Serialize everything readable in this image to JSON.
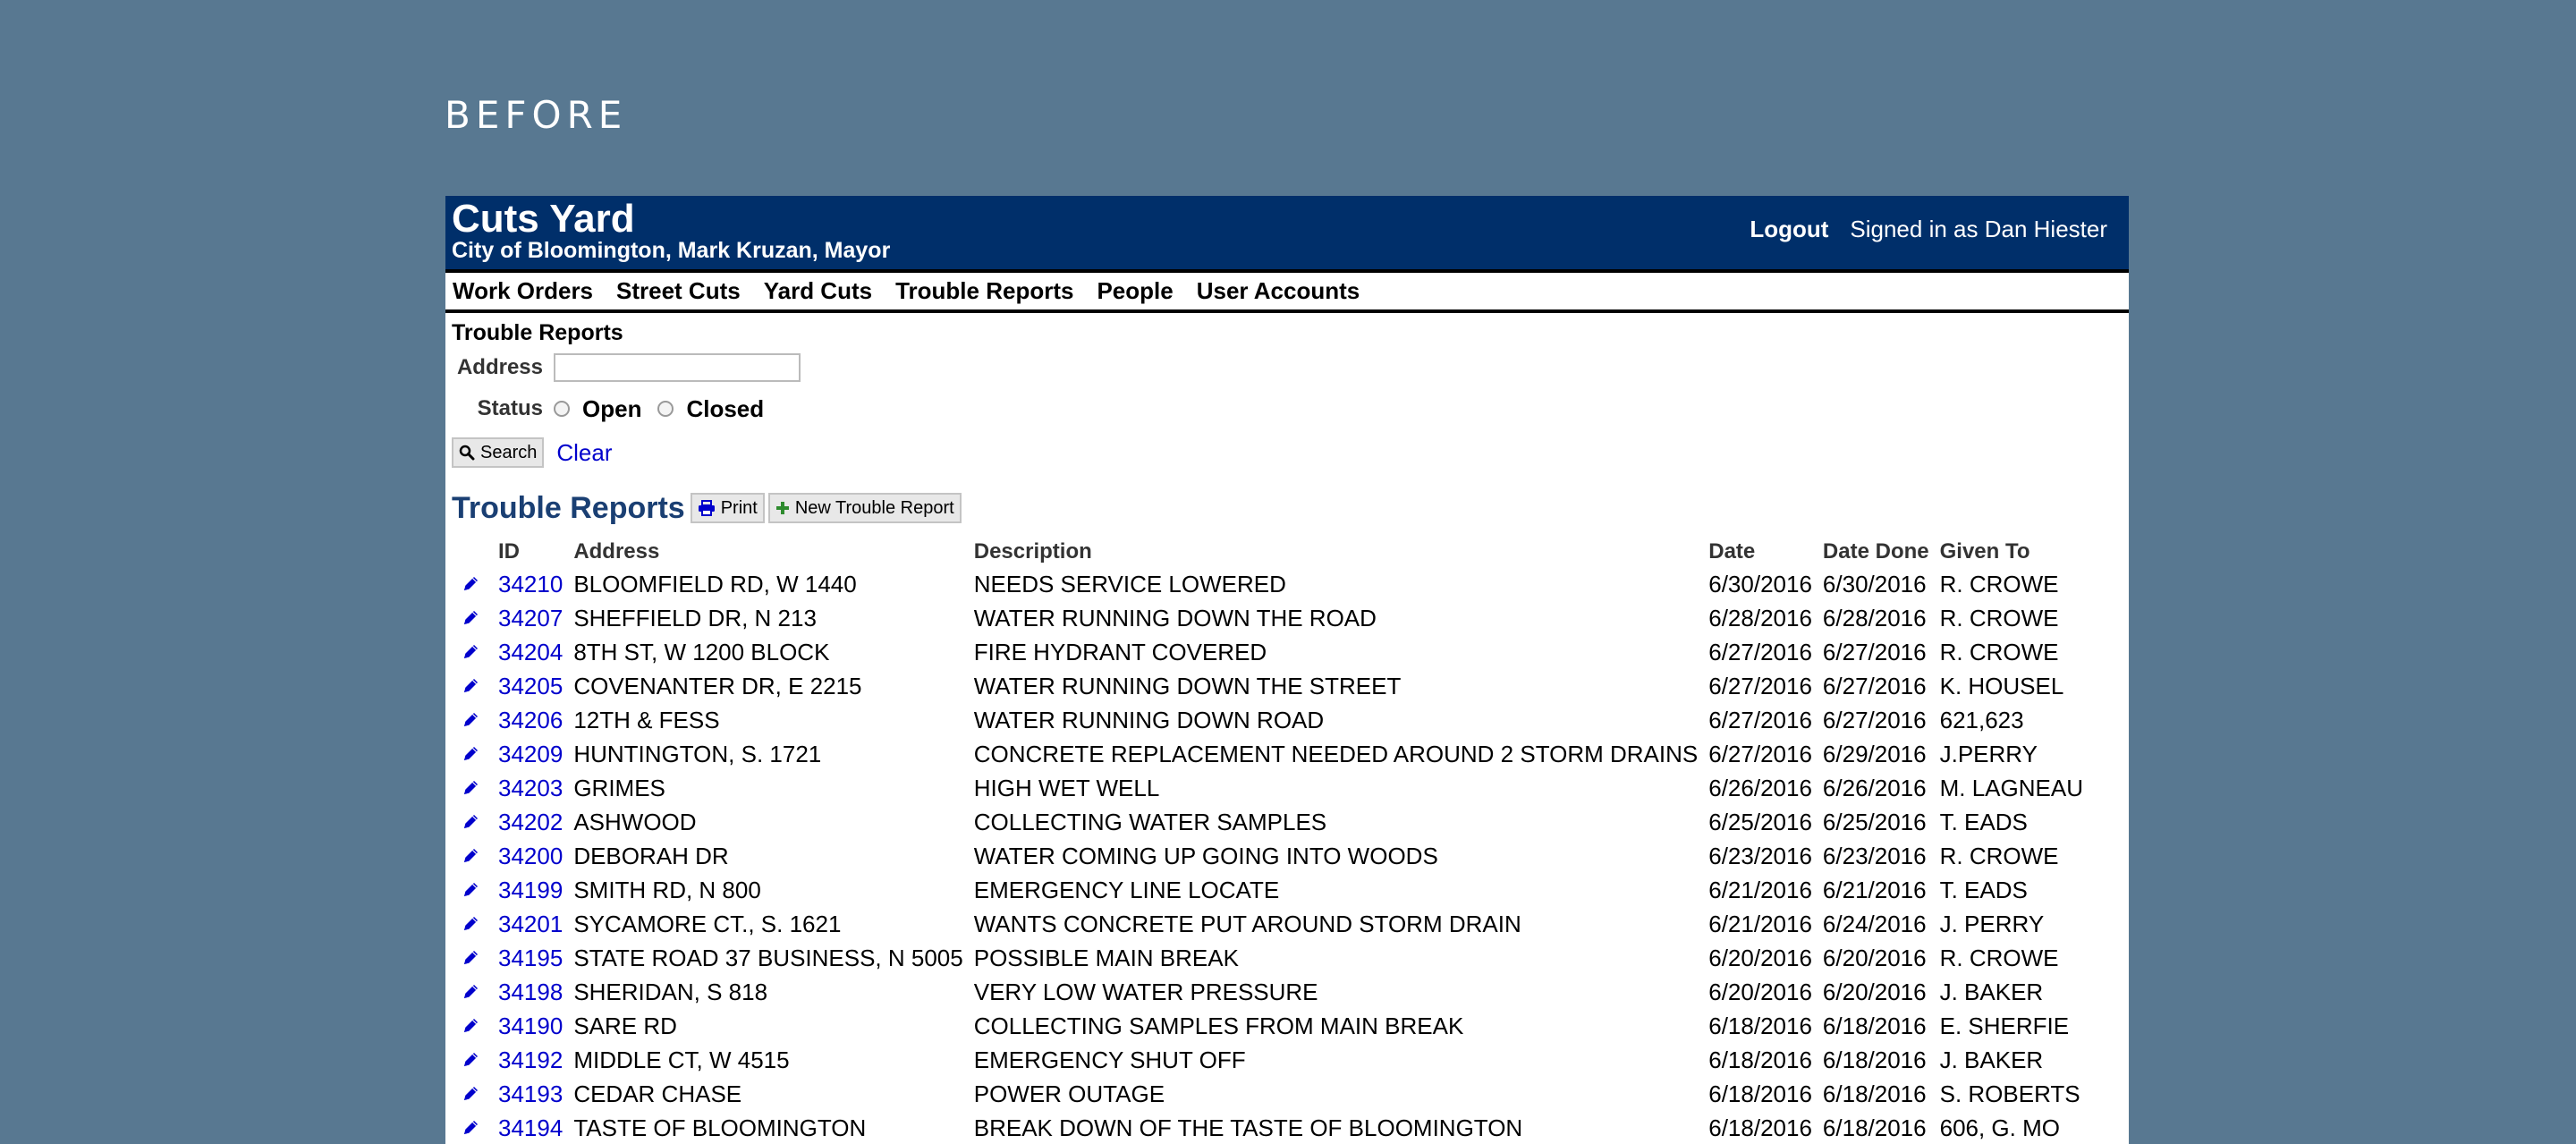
{
  "page_label": "BEFORE",
  "header": {
    "title": "Cuts Yard",
    "subtitle": "City of Bloomington, Mark Kruzan, Mayor",
    "logout_label": "Logout",
    "signed_in_text": "Signed in as Dan Hiester"
  },
  "nav": {
    "items": [
      "Work Orders",
      "Street Cuts",
      "Yard Cuts",
      "Trouble Reports",
      "People",
      "User Accounts"
    ]
  },
  "search_form": {
    "heading": "Trouble Reports",
    "address_label": "Address",
    "address_value": "",
    "status_label": "Status",
    "status_open_label": "Open",
    "status_closed_label": "Closed",
    "search_button_label": "Search",
    "clear_label": "Clear"
  },
  "reports": {
    "title": "Trouble Reports",
    "print_label": "Print",
    "new_label": "New Trouble Report",
    "columns": [
      "ID",
      "Address",
      "Description",
      "Date",
      "Date Done",
      "Given To"
    ],
    "rows": [
      {
        "id": "34210",
        "address": "BLOOMFIELD RD, W 1440",
        "description": "NEEDS SERVICE LOWERED",
        "date": "6/30/2016",
        "date_done": "6/30/2016",
        "given_to": "R. CROWE"
      },
      {
        "id": "34207",
        "address": "SHEFFIELD DR, N 213",
        "description": "WATER RUNNING DOWN THE ROAD",
        "date": "6/28/2016",
        "date_done": "6/28/2016",
        "given_to": "R. CROWE"
      },
      {
        "id": "34204",
        "address": "8TH ST, W 1200 BLOCK",
        "description": "FIRE HYDRANT COVERED",
        "date": "6/27/2016",
        "date_done": "6/27/2016",
        "given_to": "R. CROWE"
      },
      {
        "id": "34205",
        "address": "COVENANTER DR, E 2215",
        "description": "WATER RUNNING DOWN THE STREET",
        "date": "6/27/2016",
        "date_done": "6/27/2016",
        "given_to": "K. HOUSEL"
      },
      {
        "id": "34206",
        "address": "12TH & FESS",
        "description": "WATER RUNNING DOWN ROAD",
        "date": "6/27/2016",
        "date_done": "6/27/2016",
        "given_to": "621,623"
      },
      {
        "id": "34209",
        "address": "HUNTINGTON, S. 1721",
        "description": "CONCRETE REPLACEMENT NEEDED AROUND 2 STORM DRAINS",
        "date": "6/27/2016",
        "date_done": "6/29/2016",
        "given_to": "J.PERRY"
      },
      {
        "id": "34203",
        "address": "GRIMES",
        "description": "HIGH WET WELL",
        "date": "6/26/2016",
        "date_done": "6/26/2016",
        "given_to": "M. LAGNEAU"
      },
      {
        "id": "34202",
        "address": "ASHWOOD",
        "description": "COLLECTING WATER SAMPLES",
        "date": "6/25/2016",
        "date_done": "6/25/2016",
        "given_to": "T. EADS"
      },
      {
        "id": "34200",
        "address": "DEBORAH DR",
        "description": "WATER COMING UP GOING INTO WOODS",
        "date": "6/23/2016",
        "date_done": "6/23/2016",
        "given_to": "R. CROWE"
      },
      {
        "id": "34199",
        "address": "SMITH RD, N 800",
        "description": "EMERGENCY LINE LOCATE",
        "date": "6/21/2016",
        "date_done": "6/21/2016",
        "given_to": "T. EADS"
      },
      {
        "id": "34201",
        "address": "SYCAMORE CT., S. 1621",
        "description": "WANTS CONCRETE PUT AROUND STORM DRAIN",
        "date": "6/21/2016",
        "date_done": "6/24/2016",
        "given_to": "J. PERRY"
      },
      {
        "id": "34195",
        "address": "STATE ROAD 37 BUSINESS, N 5005",
        "description": "POSSIBLE MAIN BREAK",
        "date": "6/20/2016",
        "date_done": "6/20/2016",
        "given_to": "R. CROWE"
      },
      {
        "id": "34198",
        "address": "SHERIDAN, S 818",
        "description": "VERY LOW WATER PRESSURE",
        "date": "6/20/2016",
        "date_done": "6/20/2016",
        "given_to": "J. BAKER"
      },
      {
        "id": "34190",
        "address": "SARE RD",
        "description": "COLLECTING SAMPLES FROM MAIN BREAK",
        "date": "6/18/2016",
        "date_done": "6/18/2016",
        "given_to": "E. SHERFIE"
      },
      {
        "id": "34192",
        "address": "MIDDLE CT, W 4515",
        "description": "EMERGENCY SHUT OFF",
        "date": "6/18/2016",
        "date_done": "6/18/2016",
        "given_to": "J. BAKER"
      },
      {
        "id": "34193",
        "address": "CEDAR CHASE",
        "description": "POWER OUTAGE",
        "date": "6/18/2016",
        "date_done": "6/18/2016",
        "given_to": "S. ROBERTS"
      },
      {
        "id": "34194",
        "address": "TASTE OF BLOOMINGTON",
        "description": "BREAK DOWN OF THE TASTE OF BLOOMINGTON",
        "date": "6/18/2016",
        "date_done": "6/18/2016",
        "given_to": "606, G. MO"
      }
    ]
  },
  "icons": {
    "edit": "pencil-icon",
    "search": "search-icon",
    "print": "print-icon",
    "add": "plus-icon"
  },
  "colors": {
    "page_background": "#587891",
    "header_background": "#002f6a",
    "link": "#0000cc",
    "section_title": "#1a3f73",
    "add_icon": "#2e8b2e"
  }
}
